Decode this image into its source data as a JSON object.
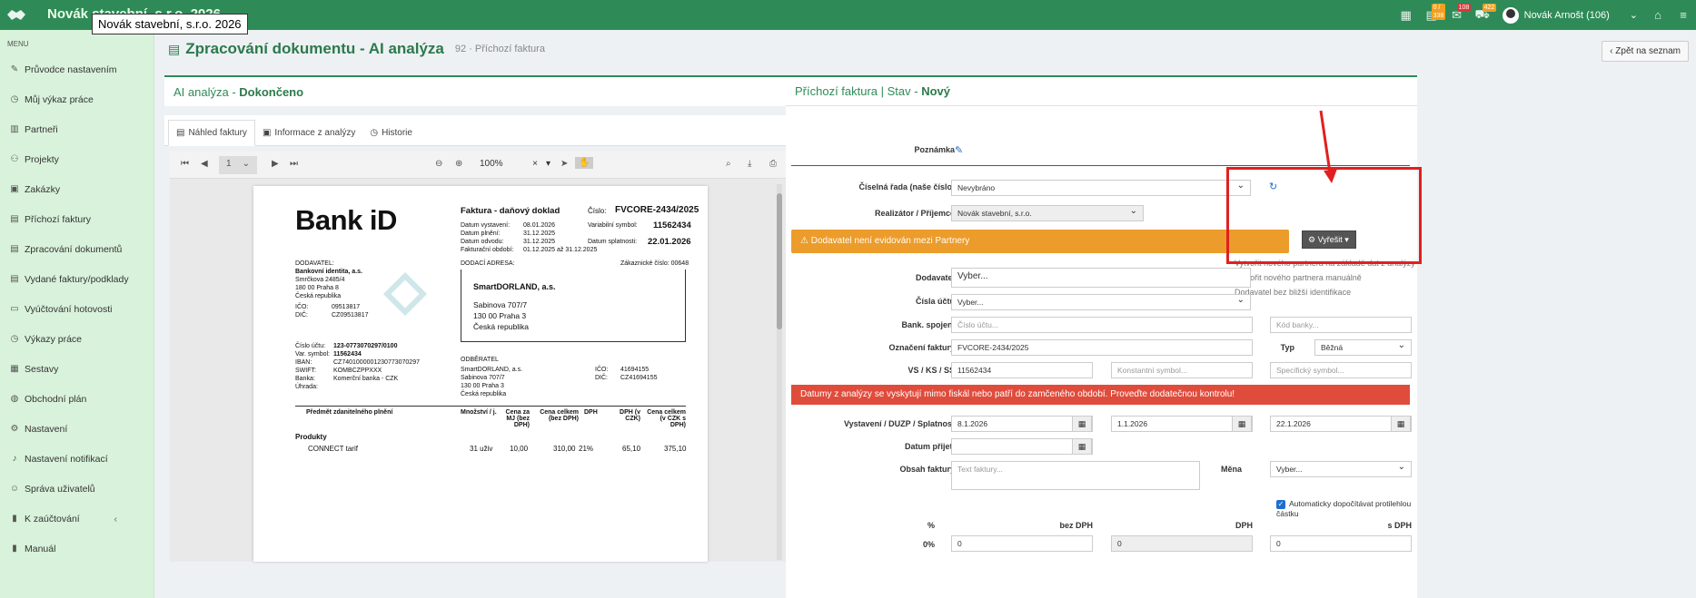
{
  "app": {
    "brand": "Novák stavební, s.r.o. 2026",
    "tooltip": "Novák stavební, s.r.o. 2026",
    "badges": {
      "b1": "0 / 338",
      "b2": "108",
      "b3": "422"
    },
    "user": "Novák Arnošt (106)"
  },
  "sidebar": {
    "menu_label": "MENU",
    "items": [
      {
        "label": "Průvodce nastavením",
        "icon": "wand-icon"
      },
      {
        "label": "Můj výkaz práce",
        "icon": "clock-icon"
      },
      {
        "label": "Partneři",
        "icon": "building-icon"
      },
      {
        "label": "Projekty",
        "icon": "sitemap-icon"
      },
      {
        "label": "Zakázky",
        "icon": "box-icon"
      },
      {
        "label": "Příchozí faktury",
        "icon": "file-icon"
      },
      {
        "label": "Zpracování dokumentů",
        "icon": "document-icon"
      },
      {
        "label": "Vydané faktury/podklady",
        "icon": "invoice-icon"
      },
      {
        "label": "Vyúčtování hotovosti",
        "icon": "cash-icon"
      },
      {
        "label": "Výkazy práce",
        "icon": "clock-icon"
      },
      {
        "label": "Sestavy",
        "icon": "chart-icon"
      },
      {
        "label": "Obchodní plán",
        "icon": "globe-icon"
      },
      {
        "label": "Nastavení",
        "icon": "gears-icon"
      },
      {
        "label": "Nastavení notifikací",
        "icon": "bell-icon"
      },
      {
        "label": "Správa uživatelů",
        "icon": "users-icon"
      },
      {
        "label": "K zaúčtování",
        "icon": "book-icon"
      },
      {
        "label": "Manuál",
        "icon": "manual-icon"
      }
    ]
  },
  "page": {
    "title": "Zpracování dokumentu - AI analýza",
    "id": "92",
    "subtitle": "· Příchozí faktura",
    "back_label": "Zpět na seznam"
  },
  "left": {
    "head_prefix": "AI analýza -",
    "head_status": "Dokončeno",
    "tabs": [
      "Náhled faktury",
      "Informace z analýzy",
      "Historie"
    ],
    "viewer": {
      "page": "1",
      "zoom": "100%"
    }
  },
  "invoice": {
    "logo": "Bank iD",
    "title": "Faktura - daňový doklad",
    "cislo_label": "Číslo:",
    "cislo": "FVCORE-2434/2025",
    "vystaveni_label": "Datum vystavení:",
    "vystaveni": "08.01.2026",
    "plneni_label": "Datum plnění:",
    "plneni": "31.12.2025",
    "odvodu_label": "Datum odvodu:",
    "odvodu": "31.12.2025",
    "obdobi_label": "Fakturační období:",
    "obdobi": "01.12.2025 až 31.12.2025",
    "vs_label": "Variabilní symbol:",
    "vs": "11562434",
    "splatnost_label": "Datum splatnosti:",
    "splatnost": "22.01.2026",
    "dodavatel_label": "DODAVATEL:",
    "dodavatel": [
      "Bankovní identita, a.s.",
      "Smrčkova 2485/4",
      "180 00  Praha 8",
      "Česká republika"
    ],
    "ico_label": "IČO:",
    "ico": "09513817",
    "dic_label": "DIČ:",
    "dic": "CZ09513817",
    "dodaci_label": "DODACÍ ADRESA:",
    "zak_cislo": "Zákaznické číslo: 00648",
    "odberatel_box": [
      "SmartDORLAND, a.s.",
      "Sabinova 707/7",
      "130 00  Praha 3",
      "Česká republika"
    ],
    "ucet_label": "Číslo účtu:",
    "ucet": "123-0773070297/0100",
    "vsym_label": "Var. symbol:",
    "vsym": "11562434",
    "iban_label": "IBAN:",
    "iban": "CZ7401000001230773070297",
    "swift_label": "SWIFT:",
    "swift": "KOMBCZPPXXX",
    "banka_label": "Banka:",
    "banka": "Komerční banka - CZK",
    "uhrada_label": "Úhrada:",
    "odberatel_label": "ODBĚRATEL",
    "odberatel": [
      "SmartDORLAND, a.s.",
      "Sabinova 707/7",
      "130 00  Praha 3",
      "Česká republika"
    ],
    "o_ico": "41694155",
    "o_dic": "CZ41694155",
    "cols": [
      "Předmět zdanitelného plnění",
      "Množství / j.",
      "Cena za MJ (bez DPH)",
      "Cena celkem (bez DPH)",
      "DPH",
      "DPH (v CZK)",
      "Cena celkem (v CZK s DPH)"
    ],
    "section": "Produkty",
    "row": [
      "CONNECT tarif",
      "31 uživ",
      "10,00",
      "310,00",
      "21%",
      "65,10",
      "375,10"
    ]
  },
  "right": {
    "head_prefix": "Příchozí faktura  |  Stav -",
    "head_status": "Nový",
    "poznamka": "Poznámka",
    "ciselna_label": "Číselná řada (naše číslo)",
    "ciselna_value": "Nevybráno",
    "realizator_label": "Realizátor / Příjemce",
    "realizator_value": "Novák stavební, s.r.o.",
    "warning": "Dodavatel není evidován mezi Partnery",
    "resolve": "Vyřešit",
    "resolve_menu": [
      "Vytvořit nového partnera na základě dat z analýzy",
      "Vytvořit nového partnera manuálně",
      "Dodavatel bez bližší identifikace"
    ],
    "dodavatel_label": "Dodavatel",
    "dodavatel_value": "Vyber...",
    "ucty_label": "Čísla účtů",
    "ucty_value": "Vyber...",
    "bank_label": "Bank. spojení",
    "bank_ph1": "Číslo účtu...",
    "bank_ph2": "Kód banky...",
    "oznaceni_label": "Označení faktury",
    "oznaceni_value": "FVCORE-2434/2025",
    "typ_label": "Typ",
    "typ_value": "Běžná",
    "vs_label": "VS / KS / SS",
    "vs_value": "11562434",
    "ks_ph": "Konstantní symbol...",
    "ss_ph": "Specifický symbol...",
    "error": "Datumy z analýzy se vyskytují mimo fiskál nebo patří do zamčeného období. Proveďte dodatečnou kontrolu!",
    "vystaveni_label": "Vystavení / DUZP / Splatnost",
    "d1": "8.1.2026",
    "d2": "1.1.2026",
    "d3": "22.1.2026",
    "prijeti_label": "Datum přijetí",
    "obsah_label": "Obsah faktury",
    "obsah_ph": "Text faktury...",
    "mena_label": "Měna",
    "mena_value": "Vyber...",
    "auto_label": "Automaticky dopočítávat protilehlou částku",
    "col_pct": "%",
    "col_bez": "bez DPH",
    "col_dph": "DPH",
    "col_s": "s DPH",
    "row_pct": "0%",
    "v1": "0",
    "v2": "0",
    "v3": "0"
  }
}
